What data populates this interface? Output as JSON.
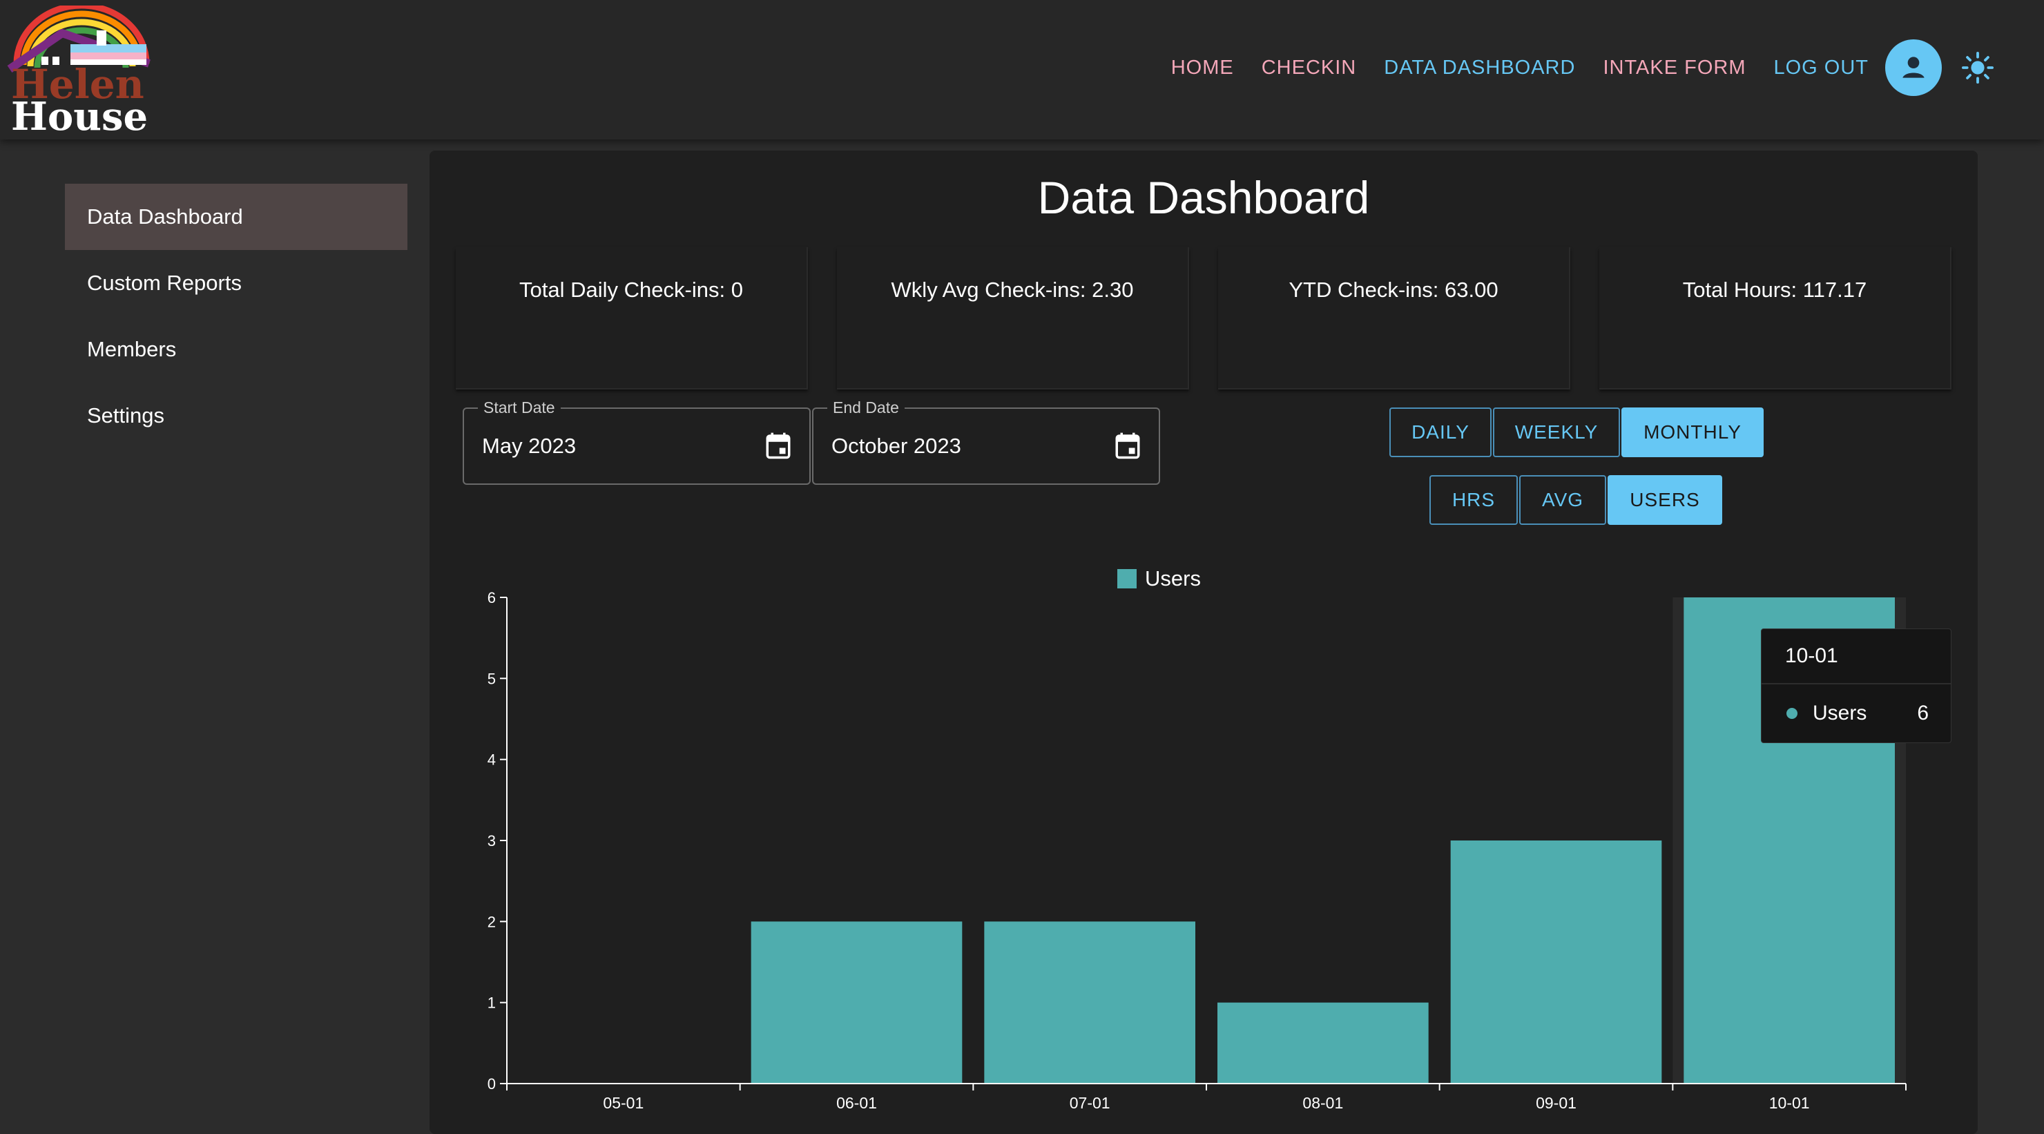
{
  "app": {
    "logo_text_line1": "Helen",
    "logo_text_line2": "House"
  },
  "nav": {
    "home": "HOME",
    "checkin": "CHECKIN",
    "data_dashboard": "DATA DASHBOARD",
    "intake_form": "INTAKE FORM",
    "log_out": "LOG OUT"
  },
  "sidebar": {
    "items": [
      {
        "label": "Data Dashboard",
        "active": true
      },
      {
        "label": "Custom Reports",
        "active": false
      },
      {
        "label": "Members",
        "active": false
      },
      {
        "label": "Settings",
        "active": false
      }
    ]
  },
  "main": {
    "title": "Data Dashboard",
    "stats": [
      "Total Daily Check-ins: 0",
      "Wkly Avg Check-ins: 2.30",
      "YTD Check-ins: 63.00",
      "Total Hours: 117.17"
    ],
    "start_date": {
      "label": "Start Date",
      "value": "May 2023"
    },
    "end_date": {
      "label": "End Date",
      "value": "October 2023"
    },
    "period_toggle": {
      "daily": "DAILY",
      "weekly": "WEEKLY",
      "monthly": "MONTHLY",
      "selected": "MONTHLY"
    },
    "metric_toggle": {
      "hrs": "HRS",
      "avg": "AVG",
      "users": "USERS",
      "selected": "USERS"
    },
    "tooltip": {
      "title": "10-01",
      "series": "Users",
      "value": "6"
    }
  },
  "colors": {
    "accent": "#66c7f4",
    "nav_pink": "#f4a7b9",
    "bar": "#4fadae"
  },
  "chart_data": {
    "type": "bar",
    "categories": [
      "05-01",
      "06-01",
      "07-01",
      "08-01",
      "09-01",
      "10-01"
    ],
    "series": [
      {
        "name": "Users",
        "values": [
          0,
          2,
          2,
          1,
          3,
          6
        ]
      }
    ],
    "yticks": [
      0,
      1,
      2,
      3,
      4,
      5,
      6
    ],
    "ylim": [
      0,
      6
    ],
    "legend": "top-center",
    "grid": false
  }
}
